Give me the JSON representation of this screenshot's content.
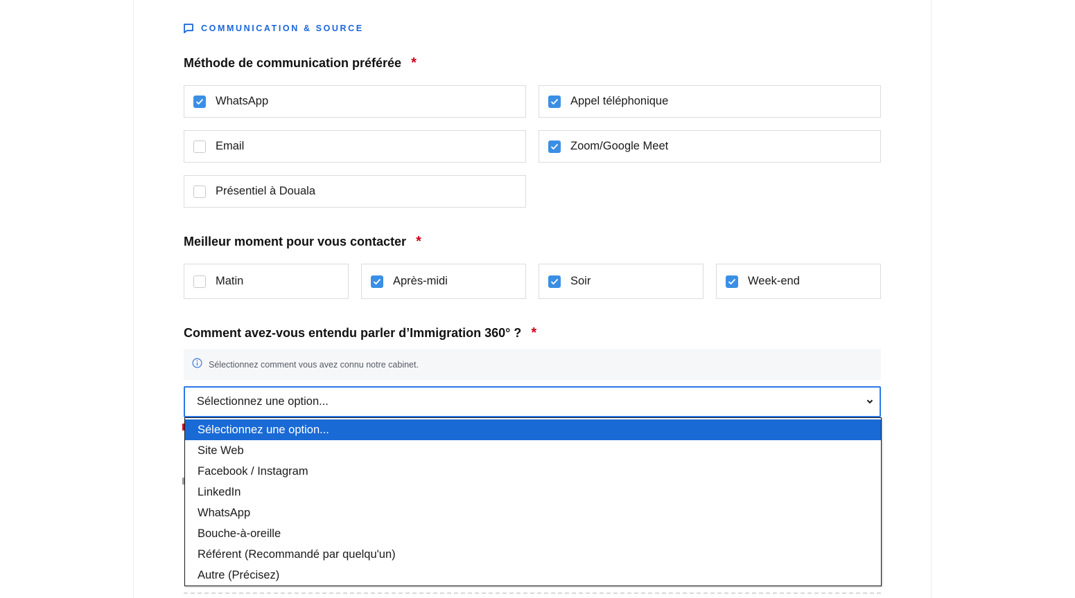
{
  "section": {
    "title": "COMMUNICATION & SOURCE",
    "icon": "chat-bubble-icon",
    "accent": "#1a66dc"
  },
  "q1": {
    "label": "Méthode de communication préférée",
    "required_mark": "*",
    "options": [
      {
        "label": "WhatsApp",
        "checked": true
      },
      {
        "label": "Appel téléphonique",
        "checked": true
      },
      {
        "label": "Email",
        "checked": false
      },
      {
        "label": "Zoom/Google Meet",
        "checked": true
      },
      {
        "label": "Présentiel à Douala",
        "checked": false
      }
    ]
  },
  "q2": {
    "label": "Meilleur moment pour vous contacter",
    "required_mark": "*",
    "options": [
      {
        "label": "Matin",
        "checked": false
      },
      {
        "label": "Après-midi",
        "checked": true
      },
      {
        "label": "Soir",
        "checked": true
      },
      {
        "label": "Week-end",
        "checked": true
      }
    ]
  },
  "q3": {
    "label": "Comment avez-vous entendu parler d’Immigration 360° ?",
    "required_mark": "*",
    "hint": "Sélectionnez comment vous avez connu notre cabinet.",
    "select_value": "Sélectionnez une option...",
    "dropdown_options": [
      "Sélectionnez une option...",
      "Site Web",
      "Facebook / Instagram",
      "LinkedIn",
      "WhatsApp",
      "Bouche-à-oreille",
      "Référent (Recommandé par quelqu'un)",
      "Autre (Précisez)"
    ],
    "highlighted_index": 0
  },
  "colors": {
    "checkbox": "#3a8fe4",
    "required": "#d0021b",
    "highlight": "#1a6ad6",
    "focus": "#2b78e4"
  }
}
